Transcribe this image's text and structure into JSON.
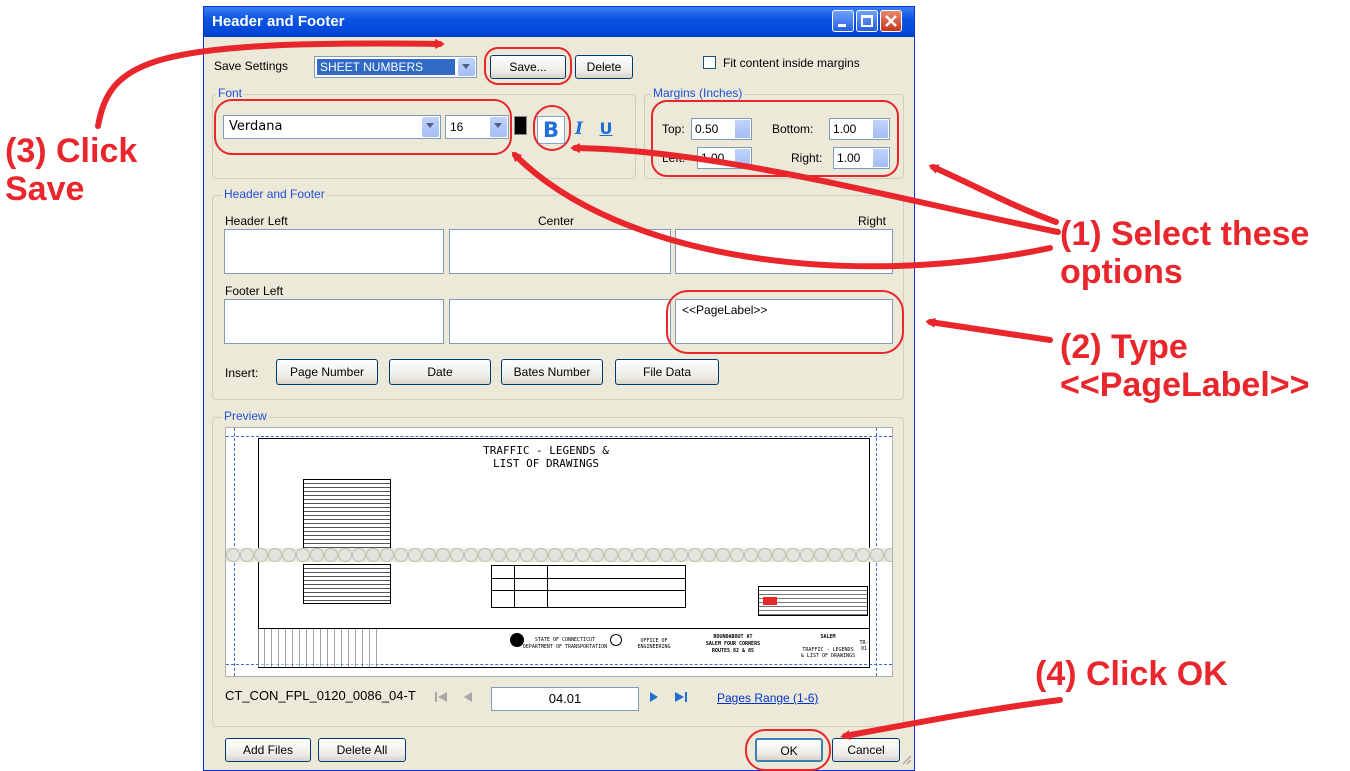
{
  "window": {
    "title": "Header and Footer"
  },
  "save_settings": {
    "label": "Save Settings",
    "value": "SHEET NUMBERS",
    "save_button": "Save...",
    "delete_button": "Delete"
  },
  "fit_content": {
    "label": "Fit content inside margins",
    "checked": false
  },
  "font": {
    "group_title": "Font",
    "family": "Verdana",
    "size": "16",
    "bold": "B",
    "italic": "I",
    "underline": "U"
  },
  "margins": {
    "group_title": "Margins (Inches)",
    "top_label": "Top:",
    "top": "0.50",
    "bottom_label": "Bottom:",
    "bottom": "1.00",
    "left_label": "Left:",
    "left": "1.00",
    "right_label": "Right:",
    "right": "1.00"
  },
  "header_footer": {
    "group_title": "Header and Footer",
    "header_left_label": "Header Left",
    "center_label": "Center",
    "right_label": "Right",
    "footer_left_label": "Footer Left",
    "footer_right_value": "<<PageLabel>>",
    "insert_label": "Insert:",
    "insert_buttons": [
      "Page Number",
      "Date",
      "Bates Number",
      "File Data"
    ]
  },
  "preview": {
    "group_title": "Preview",
    "drawing_title_line1": "TRAFFIC - LEGENDS &",
    "drawing_title_line2": "LIST OF DRAWINGS",
    "tb_state": "STATE OF CONNECTICUT",
    "tb_dept": "DEPARTMENT OF TRANSPORTATION",
    "tb_office": "OFFICE OF ENGINEERING",
    "tb_project_1": "ROUNDABOUT AT",
    "tb_project_2": "SALEM FOUR CORNERS",
    "tb_project_3": "ROUTES 82 & 85",
    "tb_town": "SALEM",
    "tb_sheet_1": "TRAFFIC - LEGENDS",
    "tb_sheet_2": "& LIST OF DRAWINGS",
    "tb_no": "TR-01"
  },
  "navigation": {
    "file_name": "CT_CON_FPL_0120_0086_04-T",
    "page_value": "04.01",
    "pages_range": "Pages Range (1-6)"
  },
  "footer_buttons": {
    "add_files": "Add Files",
    "delete_all": "Delete All",
    "ok": "OK",
    "cancel": "Cancel"
  },
  "annotations": {
    "step3_line1": "(3) Click",
    "step3_line2": "Save",
    "step1_line1": "(1) Select these",
    "step1_line2": "options",
    "step2_line1": "(2) Type",
    "step2_line2": "<<PageLabel>>",
    "step4": "(4) Click OK"
  },
  "colors": {
    "annotation_red": "#e8262b",
    "title_bar_blue": "#0a54e3",
    "dialog_bg": "#ece9d8"
  }
}
